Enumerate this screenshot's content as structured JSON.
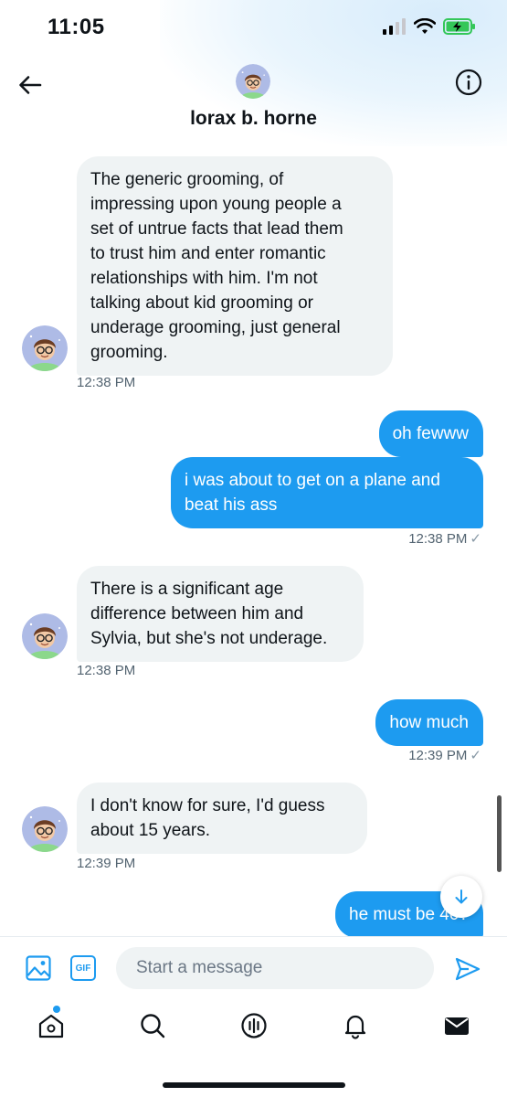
{
  "status_bar": {
    "time": "11:05"
  },
  "header": {
    "title": "lorax b. horne"
  },
  "messages": [
    {
      "side": "in",
      "lines": [
        "The generic grooming, of",
        "impressing upon young people a",
        "set of untrue facts that lead them",
        "to trust him and enter romantic",
        "relationships with him. I'm not",
        "talking about kid grooming or",
        "underage grooming, just general",
        "grooming."
      ],
      "time": "12:38 PM"
    },
    {
      "side": "out",
      "text": "oh fewww"
    },
    {
      "side": "out",
      "lines": [
        "i was about to get on a plane and",
        "beat his ass"
      ],
      "time": "12:38 PM"
    },
    {
      "side": "in",
      "lines": [
        "There is a significant age",
        "difference between him and",
        "Sylvia, but she's not underage."
      ],
      "time": "12:38 PM"
    },
    {
      "side": "out",
      "text": "how much",
      "time": "12:39 PM"
    },
    {
      "side": "in",
      "lines": [
        "I don't know for sure, I'd guess",
        "about 15 years."
      ],
      "time": "12:39 PM"
    },
    {
      "side": "out",
      "text": "he must be 40?"
    }
  ],
  "composer": {
    "placeholder": "Start a message",
    "gif_label": "GIF"
  },
  "icons": {
    "back": "arrow-left-icon",
    "info": "info-icon",
    "image": "image-icon",
    "gif": "gif-icon",
    "send": "send-icon",
    "jump": "arrow-down-icon",
    "tabs": [
      "home-icon",
      "search-icon",
      "spaces-icon",
      "notifications-icon",
      "messages-icon"
    ]
  },
  "colors": {
    "accent": "#1d9bf0",
    "incoming_bubble": "#eff3f4",
    "timestamp": "#536471"
  }
}
